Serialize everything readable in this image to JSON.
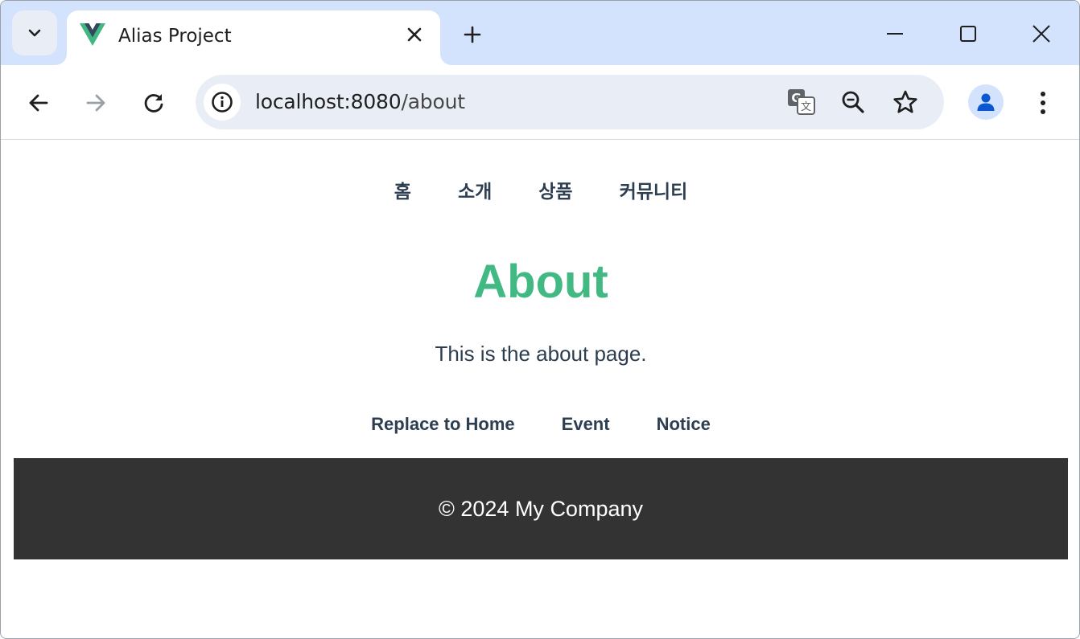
{
  "browser": {
    "tab": {
      "title": "Alias Project",
      "favicon": "vue-logo-icon"
    },
    "address_bar": {
      "host": "localhost:8080",
      "path": "/about"
    },
    "icons": {
      "tab_search": "chevron-down-icon",
      "tab_close": "close-icon",
      "new_tab": "plus-icon",
      "minimize": "minimize-icon",
      "maximize": "maximize-icon",
      "close_window": "close-icon",
      "back": "arrow-left-icon",
      "forward": "arrow-right-icon",
      "reload": "reload-icon",
      "site_info": "info-icon",
      "translate": "translate-icon",
      "zoom": "zoom-out-icon",
      "bookmark": "star-icon",
      "profile": "person-icon",
      "menu": "kebab-menu-icon"
    },
    "colors": {
      "tabstrip": "#d3e3fd",
      "omnibox": "#e9eef6",
      "avatar_fg": "#0b57d0"
    }
  },
  "page": {
    "top_nav": [
      "홈",
      "소개",
      "상품",
      "커뮤니티"
    ],
    "title": "About",
    "description": "This is the about page.",
    "sub_nav": [
      "Replace to Home",
      "Event",
      "Notice"
    ],
    "footer": "© 2024 My Company",
    "colors": {
      "title": "#42b983",
      "text": "#2c3e50",
      "footer_bg": "#333333",
      "footer_text": "#ffffff"
    }
  }
}
